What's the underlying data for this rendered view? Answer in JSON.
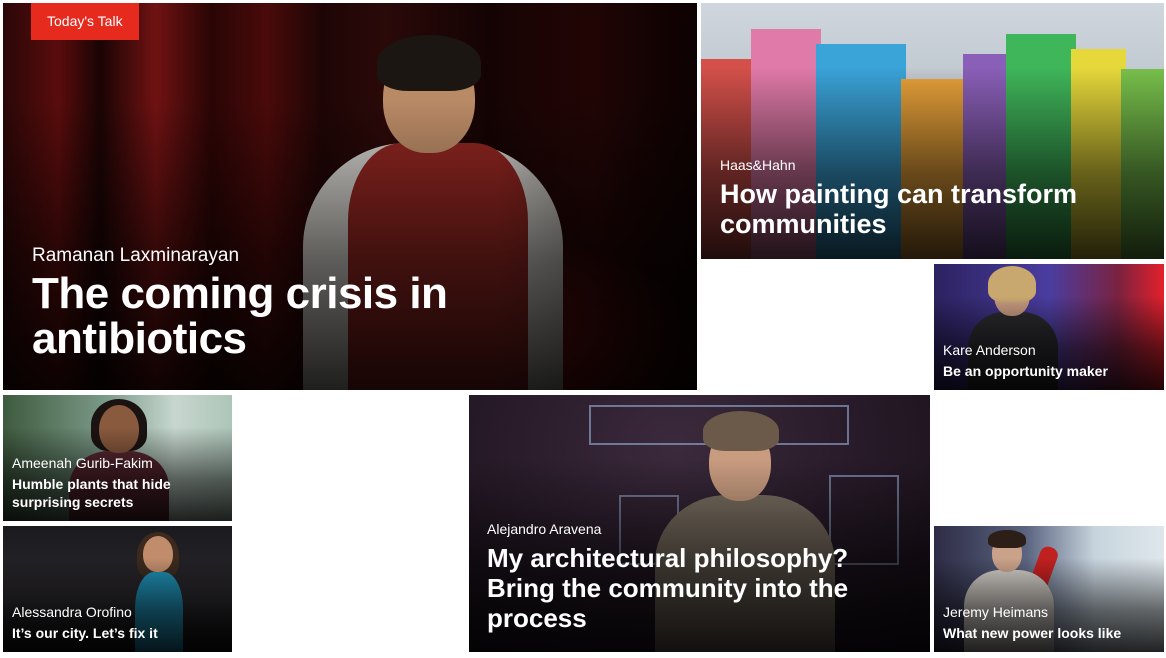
{
  "badge": {
    "label": "Today's Talk",
    "color": "#e62b1e"
  },
  "featured": {
    "speaker": "Ramanan Laxminarayan",
    "title": "The coming crisis in antibiotics"
  },
  "tiles": {
    "painting": {
      "speaker": "Haas&Hahn",
      "title": "How painting can transform communities"
    },
    "kare": {
      "speaker": "Kare Anderson",
      "title": "Be an opportunity maker"
    },
    "ameenah": {
      "speaker": "Ameenah Gurib-Fakim",
      "title": "Humble plants that hide surprising secrets"
    },
    "alessandra": {
      "speaker": "Alessandra Orofino",
      "title": "It’s our city. Let’s fix it"
    },
    "alejandro": {
      "speaker": "Alejandro Aravena",
      "title": "My architectural philosophy? Bring the community into the process"
    },
    "jeremy": {
      "speaker": "Jeremy Heimans",
      "title": "What new power looks like"
    }
  },
  "icons": {
    "featured_image": "speaker-photo",
    "tile_image": "talk-thumbnail"
  }
}
